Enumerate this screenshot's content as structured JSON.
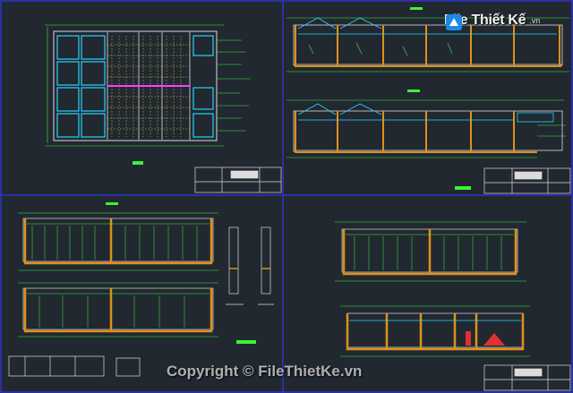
{
  "watermark": {
    "logo_text": "File Thiết Kế",
    "logo_suffix": ".vn",
    "copyright": "Copyright © FileThietKe.vn"
  },
  "colors": {
    "background": "#212830",
    "viewport_border": "#2c34c8",
    "water_blue": "#2ad3ff",
    "dim_green": "#3cf23c",
    "wall_orange": "#e0901a",
    "outline_white": "#dcdcdc",
    "magenta": "#ff3cff",
    "yellow_grid": "#e6e63c"
  },
  "icons": [
    "drawing-logo-icon"
  ]
}
